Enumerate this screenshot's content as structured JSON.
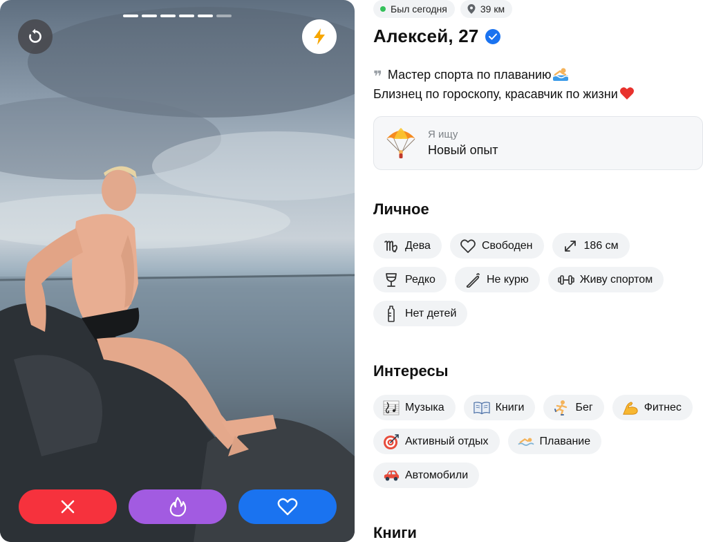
{
  "photo": {
    "progress_total": 6,
    "progress_active": 5
  },
  "actions": {
    "undo_icon": "undo-icon",
    "boost_icon": "lightning-icon",
    "dislike_icon": "close-icon",
    "superlike_icon": "flame-icon",
    "like_icon": "heart-icon"
  },
  "status": {
    "online": "Был сегодня",
    "distance": "39 км"
  },
  "profile": {
    "name": "Алексей, 27",
    "bio_line1": "Мастер спорта по плаванию",
    "bio_line2": "Близнец по гороскопу, красавчик по жизни"
  },
  "looking_for": {
    "label": "Я ищу",
    "value": "Новый опыт"
  },
  "personal": {
    "title": "Личное",
    "chips": [
      {
        "icon": "virgo-icon",
        "label": "Дева"
      },
      {
        "icon": "heart-outline-icon",
        "label": "Свободен"
      },
      {
        "icon": "height-icon",
        "label": "186 см"
      },
      {
        "icon": "wine-glass-icon",
        "label": "Редко"
      },
      {
        "icon": "no-smoking-icon",
        "label": "Не курю"
      },
      {
        "icon": "dumbbell-icon",
        "label": "Живу спортом"
      },
      {
        "icon": "baby-bottle-icon",
        "label": "Нет детей"
      }
    ]
  },
  "interests": {
    "title": "Интересы",
    "chips": [
      {
        "icon": "music-icon",
        "label": "Музыка"
      },
      {
        "icon": "book-icon",
        "label": "Книги"
      },
      {
        "icon": "running-icon",
        "label": "Бег"
      },
      {
        "icon": "biceps-icon",
        "label": "Фитнес"
      },
      {
        "icon": "target-icon",
        "label": "Активный отдых"
      },
      {
        "icon": "swimming-icon",
        "label": "Плавание"
      },
      {
        "icon": "car-icon",
        "label": "Автомобили"
      }
    ]
  },
  "books": {
    "title": "Книги"
  },
  "colors": {
    "dislike": "#f6323d",
    "superlike": "#a25be1",
    "like": "#1a73f0",
    "online": "#34c05a"
  }
}
